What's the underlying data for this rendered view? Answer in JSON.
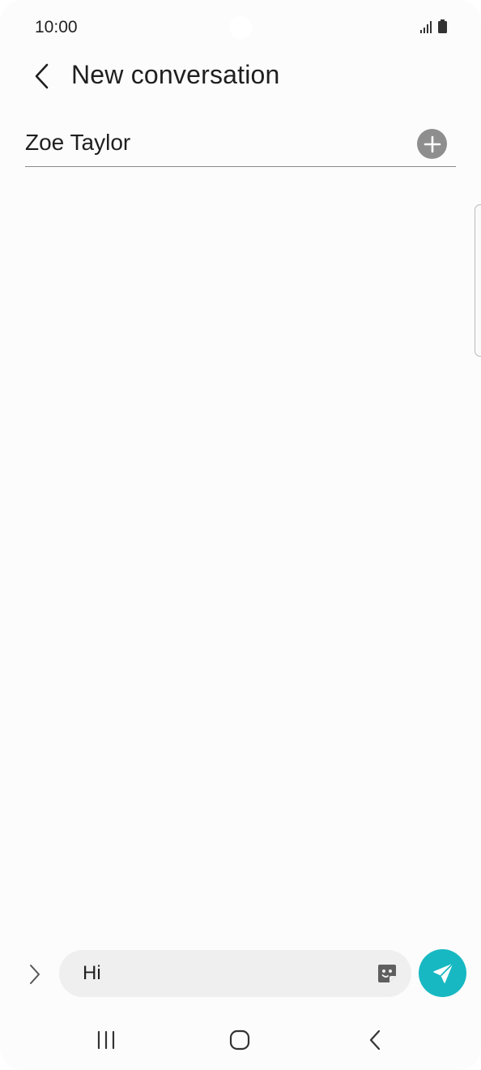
{
  "status_bar": {
    "time": "10:00",
    "icons": [
      "signal-icon",
      "battery-icon"
    ]
  },
  "header": {
    "title": "New conversation",
    "back_icon": "chevron-left-icon"
  },
  "recipient": {
    "name": "Zoe Taylor",
    "add_icon": "plus-circle-icon"
  },
  "composer": {
    "expand_icon": "chevron-right-icon",
    "message_value": "Hi",
    "sticker_icon": "sticker-icon",
    "send_icon": "send-icon"
  },
  "navigation": {
    "recent_icon": "recent-apps-icon",
    "home_icon": "home-icon",
    "back_icon": "back-icon"
  },
  "colors": {
    "accent": "#17b8c2",
    "background": "#fcfcfc",
    "input_background": "#efefef",
    "add_button": "#8e8e8e"
  }
}
